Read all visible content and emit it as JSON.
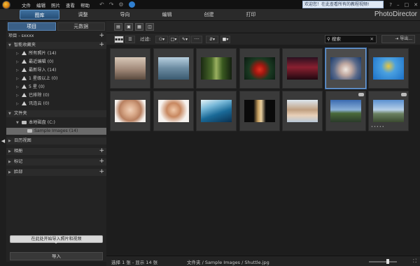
{
  "menu": {
    "items": [
      "文件",
      "编辑",
      "照片",
      "查看",
      "帮助"
    ]
  },
  "welcome_text": "欢迎您！在此查看所有的教程视频!",
  "window_controls": [
    "?",
    "–",
    "□",
    "✕"
  ],
  "modes": [
    "图库",
    "调整",
    "导向",
    "编辑",
    "创建",
    "打印"
  ],
  "brand": "PhotoDirector",
  "left": {
    "tabs": [
      "项目",
      "元数据"
    ],
    "project_label": "项目 - sxxxx",
    "sections": {
      "smart": "智能收藏夹",
      "folders": "文件夹",
      "calendar": "日历视图",
      "albums": "相册",
      "tags": "标记",
      "faces": "脸部"
    },
    "smart_items": [
      "所有照片 (14)",
      "最近编辑 (0)",
      "最新导入 (14)",
      "1 星级以上 (0)",
      "5 星 (0)",
      "已排除 (0)",
      "讯连云 (0)"
    ],
    "drive": "本地磁盘 (C:)",
    "folder": "Sample Images (14)",
    "import_tip": "在此处开始导入照片和视频",
    "import_button": "导入"
  },
  "filter": {
    "label": "过滤:",
    "search_placeholder": "搜索",
    "export": "导出..."
  },
  "status": {
    "selection": "选择 1 张 - 显示 14 张",
    "path": "文件夹 / Sample Images / Shuttle.jpg"
  },
  "thumbnails": [
    {
      "name": "skateboarder",
      "grad": "linear-gradient(180deg,#d8c8b8 0%,#a08878 55%,#5a4a3e 100%)"
    },
    {
      "name": "cliff",
      "grad": "linear-gradient(180deg,#b8d0e0 0%,#6a8aa0 50%,#3a5a70 100%)"
    },
    {
      "name": "forest",
      "grad": "linear-gradient(90deg,#1a2a12 0%,#4a6a2a 35%,#9ab060 50%,#3a5a20 70%,#142010 100%)"
    },
    {
      "name": "red-leaf",
      "grad": "radial-gradient(circle at 50% 55%,#e03020 0%,#a01810 25%,#1a3a22 55%,#0a1a10 100%)"
    },
    {
      "name": "night-city",
      "grad": "linear-gradient(180deg,#2a1020 0%,#8a2030 45%,#200810 100%)"
    },
    {
      "name": "shuttle",
      "grad": "radial-gradient(circle at 50% 55%,#f0e8e0 0%,#c0a8a0 30%,#5a6a8a 60%,#1a3a6a 100%)"
    },
    {
      "name": "snowboarder",
      "grad": "radial-gradient(circle at 50% 40%,#e8c840 0%,#4aa0e0 35%,#1a70c8 100%)"
    },
    {
      "name": "woman-portrait",
      "grad": "radial-gradient(circle at 50% 45%,#f0d0b8 0%,#d8a888 30%,#b88060 55%,#f4f0ec 80%)"
    },
    {
      "name": "smiling-woman",
      "grad": "radial-gradient(circle at 50% 45%,#f0c8a8 0%,#c88860 35%,#f6f2ee 70%)"
    },
    {
      "name": "wave",
      "grad": "linear-gradient(160deg,#e8f4f8 0%,#78b8d8 30%,#1a6a98 60%,#0a3050 100%)"
    },
    {
      "name": "doorway",
      "grad": "linear-gradient(90deg,#0a0a0a 0%,#0a0a0a 30%,#c8a060 45%,#e8d0a0 55%,#0a0a0a 70%)"
    },
    {
      "name": "woman-sitting",
      "grad": "linear-gradient(180deg,#dce6ee 0%,#c0a080 45%,#e8d0b8 70%,#b8c8d8 100%)"
    },
    {
      "name": "panorama-coast",
      "grad": "linear-gradient(180deg,#3a6ab0 0%,#8ab0d8 45%,#4a6a3a 60%,#2a3a2a 100%)"
    },
    {
      "name": "panorama-sky",
      "grad": "linear-gradient(180deg,#5a90d0 0%,#b8d0e8 45%,#6a8060 62%,#3a4a30 100%)"
    }
  ]
}
